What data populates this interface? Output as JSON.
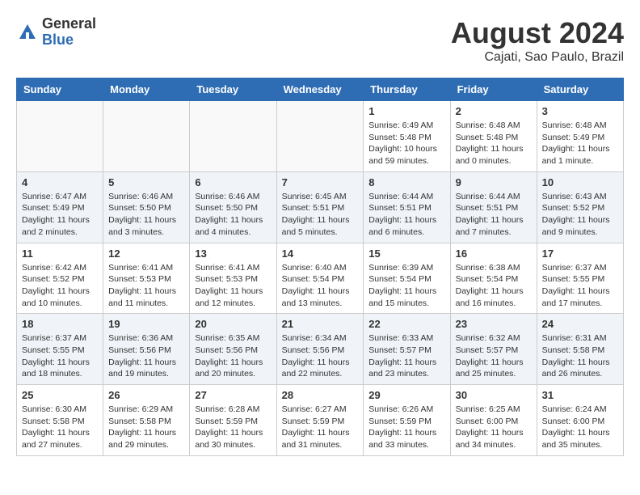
{
  "logo": {
    "general": "General",
    "blue": "Blue"
  },
  "title": "August 2024",
  "location": "Cajati, Sao Paulo, Brazil",
  "days_header": [
    "Sunday",
    "Monday",
    "Tuesday",
    "Wednesday",
    "Thursday",
    "Friday",
    "Saturday"
  ],
  "weeks": [
    [
      {
        "day": "",
        "info": ""
      },
      {
        "day": "",
        "info": ""
      },
      {
        "day": "",
        "info": ""
      },
      {
        "day": "",
        "info": ""
      },
      {
        "day": "1",
        "info": "Sunrise: 6:49 AM\nSunset: 5:48 PM\nDaylight: 10 hours and 59 minutes."
      },
      {
        "day": "2",
        "info": "Sunrise: 6:48 AM\nSunset: 5:48 PM\nDaylight: 11 hours and 0 minutes."
      },
      {
        "day": "3",
        "info": "Sunrise: 6:48 AM\nSunset: 5:49 PM\nDaylight: 11 hours and 1 minute."
      }
    ],
    [
      {
        "day": "4",
        "info": "Sunrise: 6:47 AM\nSunset: 5:49 PM\nDaylight: 11 hours and 2 minutes."
      },
      {
        "day": "5",
        "info": "Sunrise: 6:46 AM\nSunset: 5:50 PM\nDaylight: 11 hours and 3 minutes."
      },
      {
        "day": "6",
        "info": "Sunrise: 6:46 AM\nSunset: 5:50 PM\nDaylight: 11 hours and 4 minutes."
      },
      {
        "day": "7",
        "info": "Sunrise: 6:45 AM\nSunset: 5:51 PM\nDaylight: 11 hours and 5 minutes."
      },
      {
        "day": "8",
        "info": "Sunrise: 6:44 AM\nSunset: 5:51 PM\nDaylight: 11 hours and 6 minutes."
      },
      {
        "day": "9",
        "info": "Sunrise: 6:44 AM\nSunset: 5:51 PM\nDaylight: 11 hours and 7 minutes."
      },
      {
        "day": "10",
        "info": "Sunrise: 6:43 AM\nSunset: 5:52 PM\nDaylight: 11 hours and 9 minutes."
      }
    ],
    [
      {
        "day": "11",
        "info": "Sunrise: 6:42 AM\nSunset: 5:52 PM\nDaylight: 11 hours and 10 minutes."
      },
      {
        "day": "12",
        "info": "Sunrise: 6:41 AM\nSunset: 5:53 PM\nDaylight: 11 hours and 11 minutes."
      },
      {
        "day": "13",
        "info": "Sunrise: 6:41 AM\nSunset: 5:53 PM\nDaylight: 11 hours and 12 minutes."
      },
      {
        "day": "14",
        "info": "Sunrise: 6:40 AM\nSunset: 5:54 PM\nDaylight: 11 hours and 13 minutes."
      },
      {
        "day": "15",
        "info": "Sunrise: 6:39 AM\nSunset: 5:54 PM\nDaylight: 11 hours and 15 minutes."
      },
      {
        "day": "16",
        "info": "Sunrise: 6:38 AM\nSunset: 5:54 PM\nDaylight: 11 hours and 16 minutes."
      },
      {
        "day": "17",
        "info": "Sunrise: 6:37 AM\nSunset: 5:55 PM\nDaylight: 11 hours and 17 minutes."
      }
    ],
    [
      {
        "day": "18",
        "info": "Sunrise: 6:37 AM\nSunset: 5:55 PM\nDaylight: 11 hours and 18 minutes."
      },
      {
        "day": "19",
        "info": "Sunrise: 6:36 AM\nSunset: 5:56 PM\nDaylight: 11 hours and 19 minutes."
      },
      {
        "day": "20",
        "info": "Sunrise: 6:35 AM\nSunset: 5:56 PM\nDaylight: 11 hours and 20 minutes."
      },
      {
        "day": "21",
        "info": "Sunrise: 6:34 AM\nSunset: 5:56 PM\nDaylight: 11 hours and 22 minutes."
      },
      {
        "day": "22",
        "info": "Sunrise: 6:33 AM\nSunset: 5:57 PM\nDaylight: 11 hours and 23 minutes."
      },
      {
        "day": "23",
        "info": "Sunrise: 6:32 AM\nSunset: 5:57 PM\nDaylight: 11 hours and 25 minutes."
      },
      {
        "day": "24",
        "info": "Sunrise: 6:31 AM\nSunset: 5:58 PM\nDaylight: 11 hours and 26 minutes."
      }
    ],
    [
      {
        "day": "25",
        "info": "Sunrise: 6:30 AM\nSunset: 5:58 PM\nDaylight: 11 hours and 27 minutes."
      },
      {
        "day": "26",
        "info": "Sunrise: 6:29 AM\nSunset: 5:58 PM\nDaylight: 11 hours and 29 minutes."
      },
      {
        "day": "27",
        "info": "Sunrise: 6:28 AM\nSunset: 5:59 PM\nDaylight: 11 hours and 30 minutes."
      },
      {
        "day": "28",
        "info": "Sunrise: 6:27 AM\nSunset: 5:59 PM\nDaylight: 11 hours and 31 minutes."
      },
      {
        "day": "29",
        "info": "Sunrise: 6:26 AM\nSunset: 5:59 PM\nDaylight: 11 hours and 33 minutes."
      },
      {
        "day": "30",
        "info": "Sunrise: 6:25 AM\nSunset: 6:00 PM\nDaylight: 11 hours and 34 minutes."
      },
      {
        "day": "31",
        "info": "Sunrise: 6:24 AM\nSunset: 6:00 PM\nDaylight: 11 hours and 35 minutes."
      }
    ]
  ]
}
